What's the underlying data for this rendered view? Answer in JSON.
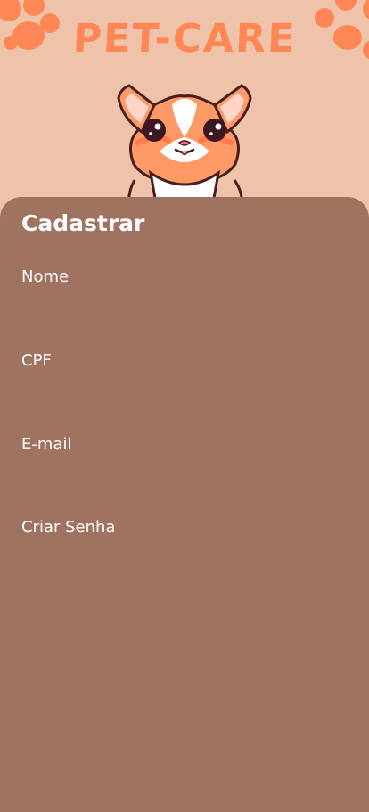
{
  "app": {
    "brand": "PET-CARE"
  },
  "form": {
    "title": "Cadastrar",
    "fields": {
      "nome": {
        "label": "Nome",
        "value": ""
      },
      "cpf": {
        "label": "CPF",
        "value": ""
      },
      "email": {
        "label": "E-mail",
        "value": ""
      },
      "senha": {
        "label": "Criar Senha",
        "value": ""
      }
    }
  },
  "theme": {
    "background": "#efc3aa",
    "card": "#a07260",
    "brand_orange": "#ff8756"
  },
  "icons": {
    "left_decoration": "paw-print-icon",
    "right_decoration": "paw-print-icon",
    "mascot": "cat-mascot"
  }
}
